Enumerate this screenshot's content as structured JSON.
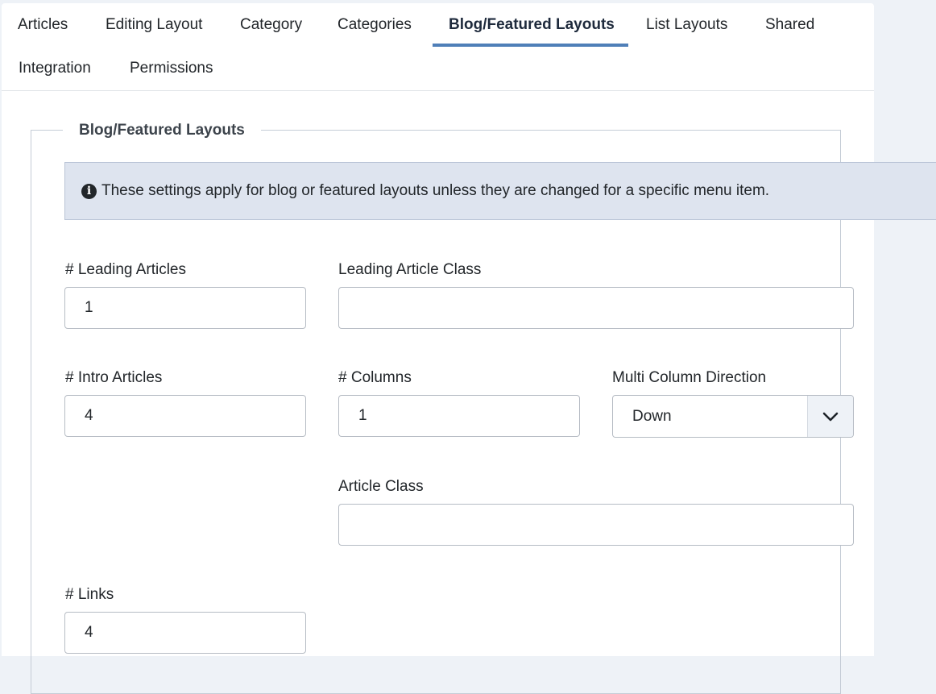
{
  "tabs": [
    {
      "label": "Articles"
    },
    {
      "label": "Editing Layout"
    },
    {
      "label": "Category"
    },
    {
      "label": "Categories"
    },
    {
      "label": "Blog/Featured Layouts",
      "active": true
    },
    {
      "label": "List Layouts"
    },
    {
      "label": "Shared"
    },
    {
      "label": "Integration"
    },
    {
      "label": "Permissions"
    }
  ],
  "fieldset": {
    "legend": "Blog/Featured Layouts",
    "alert": "These settings apply for blog or featured layouts unless they are changed for a specific menu item."
  },
  "fields": {
    "leading_articles": {
      "label": "# Leading Articles",
      "value": "1"
    },
    "leading_article_class": {
      "label": "Leading Article Class",
      "value": ""
    },
    "intro_articles": {
      "label": "# Intro Articles",
      "value": "4"
    },
    "columns": {
      "label": "# Columns",
      "value": "1"
    },
    "multi_column_direction": {
      "label": "Multi Column Direction",
      "value": "Down"
    },
    "article_class": {
      "label": "Article Class",
      "value": ""
    },
    "links": {
      "label": "# Links",
      "value": "4"
    }
  },
  "colors": {
    "active_tab_indicator": "#4f7fb8",
    "alert_background": "#dee4ef",
    "page_background": "#eef2f7"
  },
  "icons": {
    "alert": "info-circle-icon",
    "select": "chevron-down-icon"
  }
}
